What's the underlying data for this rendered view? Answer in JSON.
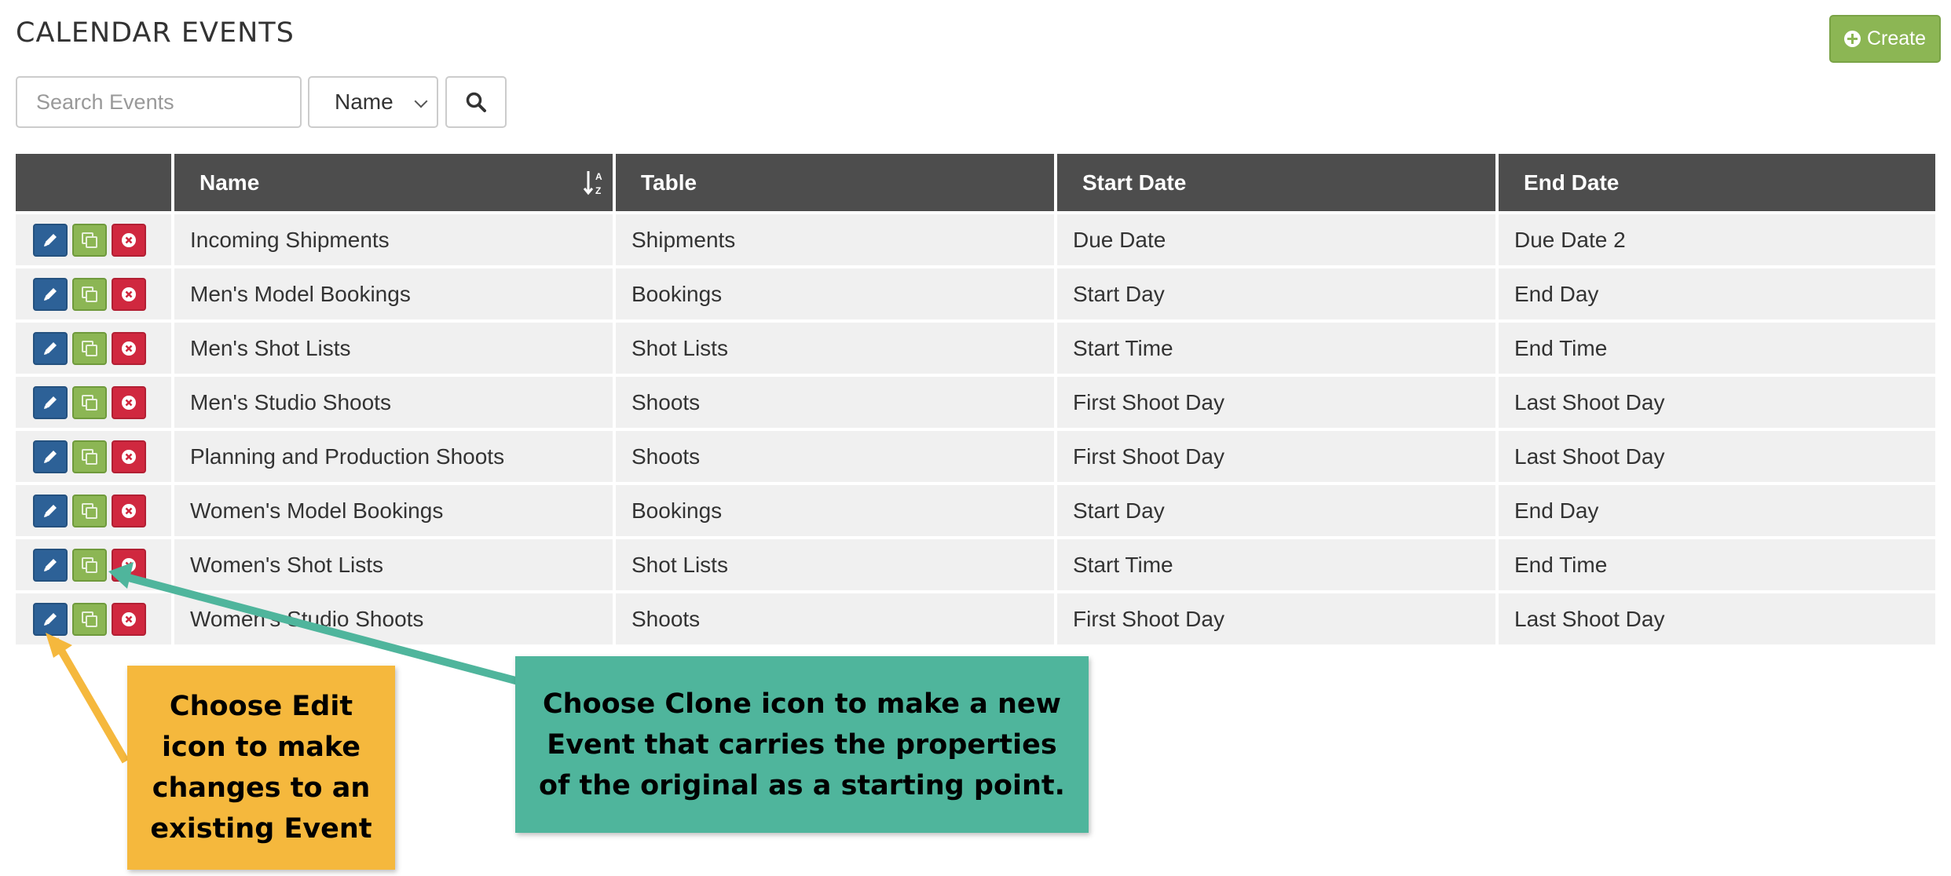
{
  "header": {
    "title": "CALENDAR EVENTS",
    "create_label": "Create"
  },
  "search": {
    "placeholder": "Search Events",
    "field_selected": "Name"
  },
  "table": {
    "columns": [
      "Name",
      "Table",
      "Start Date",
      "End Date"
    ],
    "sorted_column": "Name",
    "rows": [
      {
        "name": "Incoming Shipments",
        "table": "Shipments",
        "start": "Due Date",
        "end": "Due Date 2"
      },
      {
        "name": "Men's Model Bookings",
        "table": "Bookings",
        "start": "Start Day",
        "end": "End Day"
      },
      {
        "name": "Men's Shot Lists",
        "table": "Shot Lists",
        "start": "Start Time",
        "end": "End Time"
      },
      {
        "name": "Men's Studio Shoots",
        "table": "Shoots",
        "start": "First Shoot Day",
        "end": "Last Shoot Day"
      },
      {
        "name": "Planning and Production Shoots",
        "table": "Shoots",
        "start": "First Shoot Day",
        "end": "Last Shoot Day"
      },
      {
        "name": "Women's Model Bookings",
        "table": "Bookings",
        "start": "Start Day",
        "end": "End Day"
      },
      {
        "name": "Women's Shot Lists",
        "table": "Shot Lists",
        "start": "Start Time",
        "end": "End Time"
      },
      {
        "name": "Women's Studio Shoots",
        "table": "Shoots",
        "start": "First Shoot Day",
        "end": "Last Shoot Day"
      }
    ]
  },
  "annotations": {
    "edit_note": "Choose Edit icon to make changes to an existing Event",
    "clone_note": "Choose Clone icon to make a new Event that carries the properties of the original as a starting point."
  },
  "colors": {
    "edit": "#2d6197",
    "clone": "#8cb654",
    "delete": "#d0283f",
    "header_bg": "#4d4d4d",
    "callout_yellow": "#f5b83d",
    "callout_green": "#4fb59c"
  }
}
